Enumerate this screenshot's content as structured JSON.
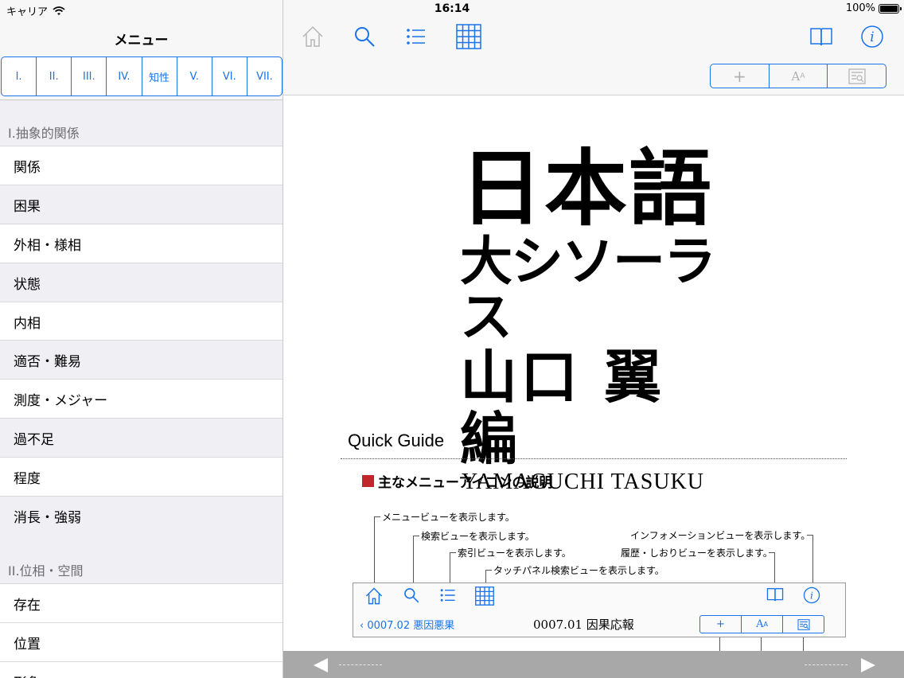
{
  "status": {
    "carrier": "キャリア",
    "time": "16:14",
    "battery": "100%"
  },
  "sidebar": {
    "title": "メニュー",
    "segments": [
      "I.",
      "II.",
      "III.",
      "IV.",
      "知性",
      "V.",
      "VI.",
      "VII."
    ],
    "section1": "I.抽象的関係",
    "items1": [
      "関係",
      "困果",
      "外相・様相",
      "状態",
      "内相",
      "適否・難易",
      "測度・メジャー",
      "過不足",
      "程度",
      "消長・強弱"
    ],
    "section2": "II.位相・空間",
    "items2": [
      "存在",
      "位置",
      "形象"
    ]
  },
  "toolbar": {
    "icons": [
      "home-icon",
      "search-icon",
      "list-icon",
      "grid-icon",
      "book-icon",
      "info-icon"
    ],
    "segment": [
      "+",
      "A",
      "▤"
    ],
    "segment_sub": "A"
  },
  "content": {
    "logo_line1": "日本語",
    "logo_line2": "大シソーラス",
    "logo_line3": "山口 翼 編",
    "logo_line4": "YAMAGUCHI TASUKU",
    "quick_guide": "Quick Guide",
    "subheading": "主なメニューアイコンの説明",
    "notes": {
      "menu": "メニュービューを表示します。",
      "search": "検索ビューを表示します。",
      "index": "索引ビューを表示します。",
      "touch": "タッチパネル検索ビューを表示します。",
      "info": "インフォメーションビューを表示します。",
      "history": "履歴・しおりビューを表示します。"
    },
    "mock": {
      "back": "0007.02 悪因悪果",
      "title": "0007.01 因果応報"
    }
  },
  "colors": {
    "accent": "#1a73e8",
    "red": "#c0272d"
  }
}
